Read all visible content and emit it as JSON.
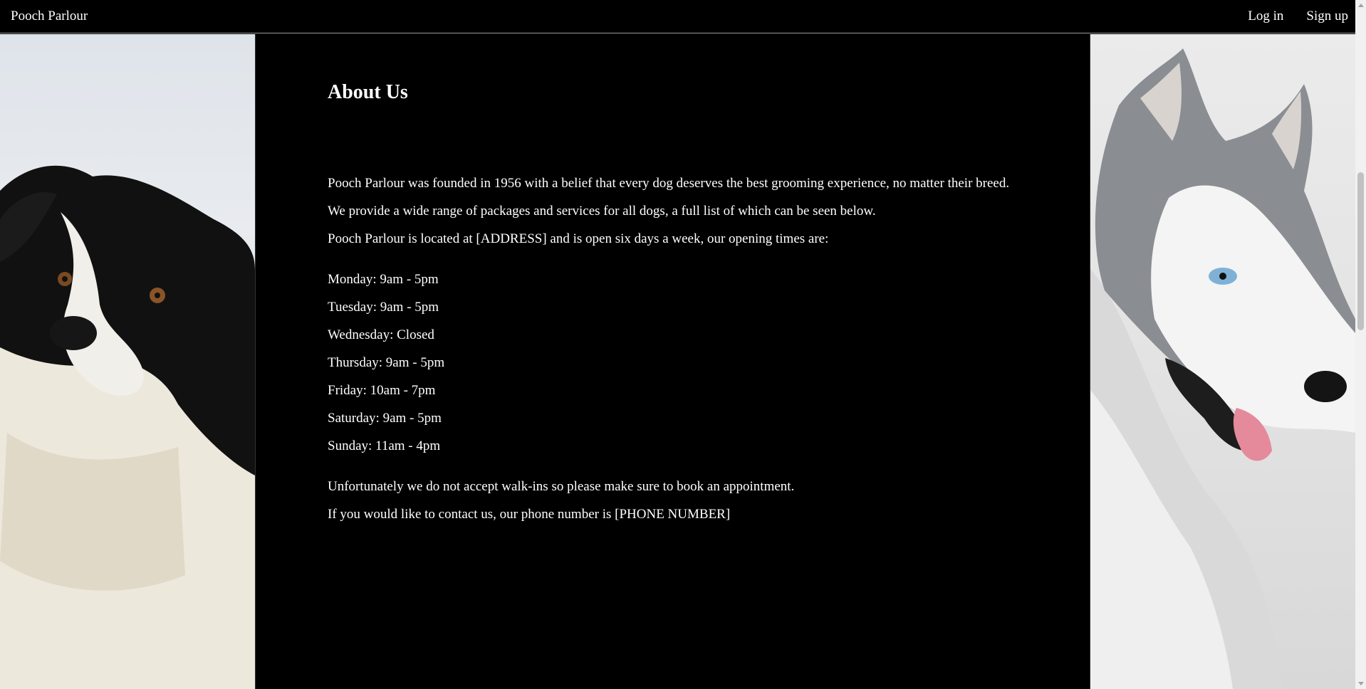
{
  "nav": {
    "brand": "Pooch Parlour",
    "login": "Log in",
    "signup": "Sign up"
  },
  "about": {
    "title": "About Us",
    "intro": [
      "Pooch Parlour was founded in 1956 with a belief that every dog deserves the best grooming experience, no matter their breed.",
      "We provide a wide range of packages and services for all dogs, a full list of which can be seen below.",
      "Pooch Parlour is located at [ADDRESS] and is open six days a week, our opening times are:"
    ],
    "hours": [
      "Monday: 9am - 5pm",
      "Tuesday: 9am - 5pm",
      "Wednesday: Closed",
      "Thursday: 9am - 5pm",
      "Friday: 10am - 7pm",
      "Saturday: 9am - 5pm",
      "Sunday: 11am - 4pm"
    ],
    "closing": [
      "Unfortunately we do not accept walk-ins so please make sure to book an appointment.",
      "If you would like to contact us, our phone number is [PHONE NUMBER]"
    ]
  },
  "images": {
    "left": "border-collie-photo",
    "right": "husky-photo"
  },
  "colors": {
    "background": "#000000",
    "text": "#ffffff",
    "nav_border": "#9a9a9a"
  }
}
